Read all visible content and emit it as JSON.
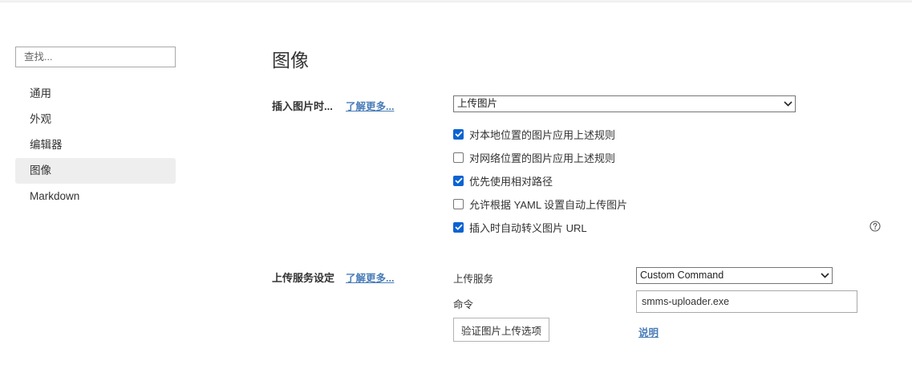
{
  "search": {
    "placeholder": "查找..."
  },
  "sidebar": {
    "items": [
      {
        "label": "通用",
        "active": false
      },
      {
        "label": "外观",
        "active": false
      },
      {
        "label": "编辑器",
        "active": false
      },
      {
        "label": "图像",
        "active": true
      },
      {
        "label": "Markdown",
        "active": false
      }
    ]
  },
  "page": {
    "title": "图像"
  },
  "insert": {
    "label": "插入图片时...",
    "learn_more": "了解更多...",
    "select_value": "上传图片",
    "options": [
      {
        "label": "对本地位置的图片应用上述规则",
        "checked": true
      },
      {
        "label": "对网络位置的图片应用上述规则",
        "checked": false
      },
      {
        "label": "优先使用相对路径",
        "checked": true
      },
      {
        "label": "允许根据 YAML 设置自动上传图片",
        "checked": false
      },
      {
        "label": "插入时自动转义图片 URL",
        "checked": true
      }
    ],
    "help_icon": "question-circle-icon"
  },
  "upload": {
    "label": "上传服务设定",
    "learn_more": "了解更多...",
    "service_label": "上传服务",
    "service_value": "Custom Command",
    "command_label": "命令",
    "command_value": "smms-uploader.exe",
    "verify_button": "验证图片上传选项",
    "explain_link": "说明"
  },
  "colors": {
    "accent": "#0a63d1",
    "link": "#4a7db8",
    "active_bg": "#eeeeee"
  }
}
